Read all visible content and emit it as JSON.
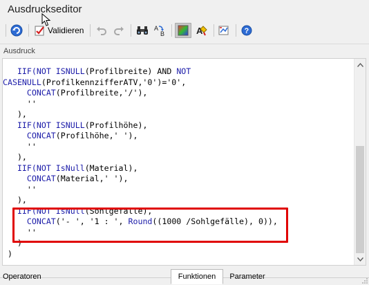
{
  "window": {
    "title": "Ausdruckseditor"
  },
  "toolbar": {
    "validate_label": "Validieren"
  },
  "section": {
    "label": "Ausdruck"
  },
  "editor": {
    "lines": [
      [
        [
          "kw",
          "   IIF("
        ],
        [
          "kw",
          "NOT ISNULL"
        ],
        [
          "plain",
          "(Profilbreite) AND "
        ],
        [
          "kw",
          "NOT"
        ]
      ],
      [
        [
          "kw",
          "CASENULL"
        ],
        [
          "plain",
          "(ProfilkennzifferATV,'0')='0',"
        ]
      ],
      [
        [
          "plain",
          "     "
        ],
        [
          "kw",
          "CONCAT"
        ],
        [
          "plain",
          "(Profilbreite,'/'),"
        ]
      ],
      [
        [
          "plain",
          "     ''"
        ]
      ],
      [
        [
          "plain",
          "   ),"
        ]
      ],
      [
        [
          "kw",
          "   IIF("
        ],
        [
          "kw",
          "NOT ISNULL"
        ],
        [
          "plain",
          "(Profilhöhe),"
        ]
      ],
      [
        [
          "plain",
          "     "
        ],
        [
          "kw",
          "CONCAT"
        ],
        [
          "plain",
          "(Profilhöhe,' '),"
        ]
      ],
      [
        [
          "plain",
          "     ''"
        ]
      ],
      [
        [
          "plain",
          "   ),"
        ]
      ],
      [
        [
          "kw",
          "   IIF("
        ],
        [
          "kw",
          "NOT IsNull"
        ],
        [
          "plain",
          "(Material),"
        ]
      ],
      [
        [
          "plain",
          "     "
        ],
        [
          "kw",
          "CONCAT"
        ],
        [
          "plain",
          "(Material,' '),"
        ]
      ],
      [
        [
          "plain",
          "     ''"
        ]
      ],
      [
        [
          "plain",
          "   ),"
        ]
      ],
      [
        [
          "kw",
          "   IIF("
        ],
        [
          "kw",
          "NOT IsNull"
        ],
        [
          "plain",
          "(Sohlgefälle),"
        ]
      ],
      [
        [
          "plain",
          "     "
        ],
        [
          "kw",
          "CONCAT"
        ],
        [
          "plain",
          "('- ', '1 : ', "
        ],
        [
          "kw",
          "Round"
        ],
        [
          "plain",
          "((1000 /Sohlgefälle), 0)),"
        ]
      ],
      [
        [
          "plain",
          "     ''"
        ]
      ],
      [
        [
          "plain",
          "   )"
        ]
      ],
      [
        [
          "plain",
          " )"
        ]
      ]
    ]
  },
  "bottom": {
    "left_label": "Operatoren",
    "tabs": [
      "Funktionen",
      "Parameter"
    ],
    "active_tab": "Funktionen"
  }
}
